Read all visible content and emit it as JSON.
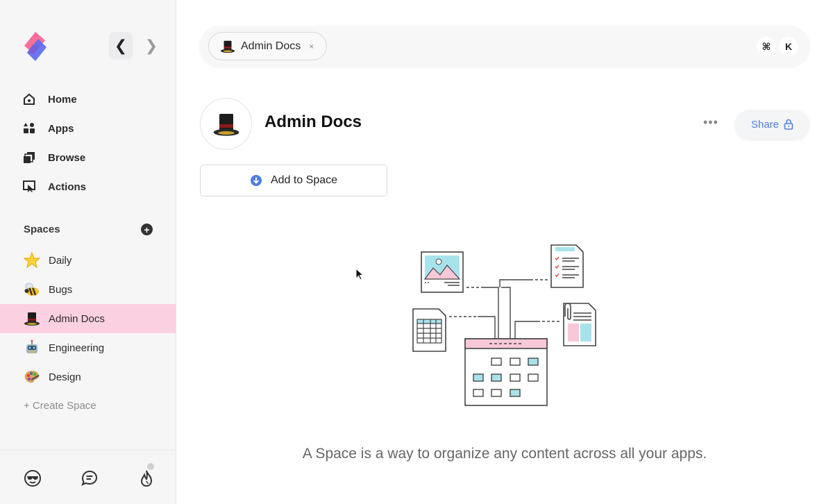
{
  "window": {
    "controls": [
      "close",
      "minimize",
      "zoom"
    ]
  },
  "sidebar": {
    "back_label": "❮",
    "forward_label": "❯",
    "nav": [
      {
        "label": "Home",
        "icon": "home-icon"
      },
      {
        "label": "Apps",
        "icon": "apps-icon"
      },
      {
        "label": "Browse",
        "icon": "browse-icon"
      },
      {
        "label": "Actions",
        "icon": "actions-icon"
      }
    ],
    "spaces_header": "Spaces",
    "add_space_symbol": "+",
    "spaces": [
      {
        "label": "Daily",
        "icon": "star-emoji"
      },
      {
        "label": "Bugs",
        "icon": "bee-emoji"
      },
      {
        "label": "Admin Docs",
        "icon": "top-hat-emoji",
        "active": true
      },
      {
        "label": "Engineering",
        "icon": "robot-emoji"
      },
      {
        "label": "Design",
        "icon": "palette-emoji"
      }
    ],
    "create_space_label": "+ Create Space",
    "footer_icons": [
      "smiley-sunglasses-icon",
      "chat-icon",
      "flame-icon"
    ]
  },
  "search": {
    "chip_label": "Admin Docs",
    "chip_close": "×",
    "shortcut": [
      "⌘",
      "K"
    ]
  },
  "space": {
    "title": "Admin Docs",
    "more_label": "•••",
    "share_label": "Share",
    "add_label": "Add to Space",
    "empty_caption": "A Space is a way to organize any content across all your apps."
  },
  "colors": {
    "accent": "#4f7de0",
    "active_space": "#fbd1e2",
    "illustration_pink": "#f7c8d8",
    "illustration_teal": "#a8e3ec"
  }
}
